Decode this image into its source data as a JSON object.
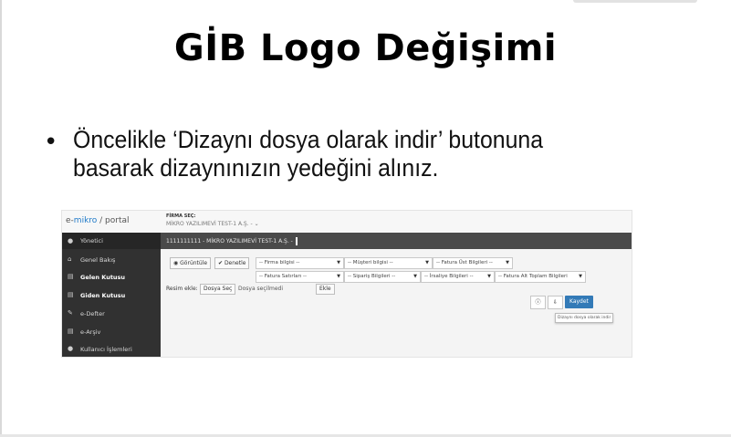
{
  "slide": {
    "title": "GİB Logo Değişimi",
    "bullet_marker": "•",
    "bullet_text": "Öncelikle ‘Dizaynı dosya olarak indir’ butonuna basarak dizaynınızın yedeğini alınız."
  },
  "app": {
    "brand_prefix": "e-",
    "brand_accent": "mikro",
    "brand_suffix": " / portal",
    "company_label": "FİRMA SEÇ:",
    "company_value": "MİKRO YAZILIMEVİ TEST-1 A.Ş. - ⌄",
    "content_header": "1111111111 - MİKRO YAZILIMEVİ TEST-1 A.Ş. -",
    "sidebar": {
      "user": {
        "icon": "user-icon",
        "label": "Yönetici"
      },
      "items": [
        {
          "icon": "home-icon",
          "label": "Genel Bakış",
          "bold": false
        },
        {
          "icon": "inbox-icon",
          "label": "Gelen Kutusu",
          "bold": true
        },
        {
          "icon": "outbox-icon",
          "label": "Giden Kutusu",
          "bold": true
        },
        {
          "icon": "edit-icon",
          "label": "e-Defter",
          "bold": false
        },
        {
          "icon": "archive-icon",
          "label": "e-Arşiv",
          "bold": false
        },
        {
          "icon": "users-icon",
          "label": "Kullanıcı İşlemleri",
          "bold": false
        }
      ]
    },
    "toolbar": {
      "view_button": "Görüntüle",
      "check_button": "Denetle",
      "row1_selects": [
        "-- Firma bilgisi --",
        "-- Müşteri bilgisi --",
        "-- Fatura Üst Bilgileri --"
      ],
      "row2_selects": [
        "-- Fatura Satırları --",
        "-- Sipariş Bilgileri --",
        "-- İrsaliye Bilgileri --",
        "-- Fatura Alt Toplam Bilgileri"
      ],
      "image_label": "Resim ekle:",
      "choose_file": "Dosya Seç",
      "no_file": "Dosya seçilmedi",
      "add_button": "Ekle",
      "save_button": "Kaydet",
      "tooltip": "Dizaynı dosya olarak indir"
    },
    "colors": {
      "primary": "#337ab7",
      "sidebar": "#313131",
      "header_bar": "#4a4a4a"
    }
  }
}
